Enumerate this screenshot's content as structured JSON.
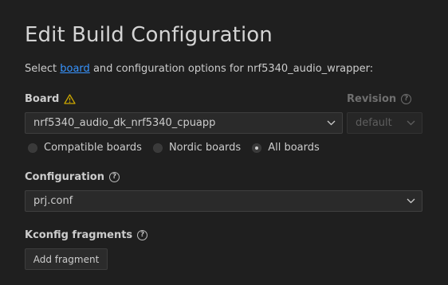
{
  "page": {
    "title": "Edit Build Configuration",
    "subtitle_prefix": "Select",
    "subtitle_link": "board",
    "subtitle_suffix": "and configuration options for nrf5340_audio_wrapper:"
  },
  "board": {
    "label": "Board",
    "selected": "nrf5340_audio_dk_nrf5340_cpuapp",
    "filter_options": [
      {
        "label": "Compatible boards",
        "checked": false
      },
      {
        "label": "Nordic boards",
        "checked": false
      },
      {
        "label": "All boards",
        "checked": true
      }
    ]
  },
  "revision": {
    "label": "Revision",
    "selected": "default"
  },
  "configuration": {
    "label": "Configuration",
    "selected": "prj.conf"
  },
  "kconfig": {
    "label": "Kconfig fragments",
    "add_button": "Add fragment"
  },
  "colors": {
    "background": "#1f1f1f",
    "link": "#3794ff",
    "warning": "#cca700"
  }
}
